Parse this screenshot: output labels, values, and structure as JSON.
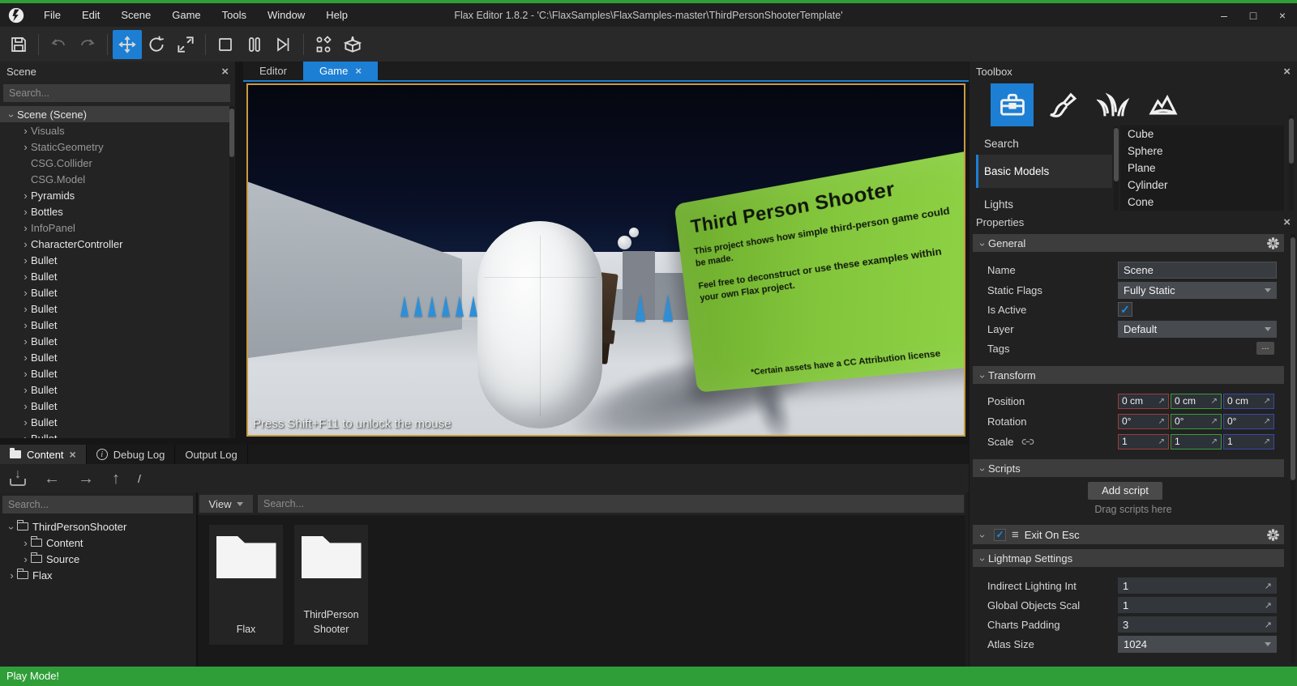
{
  "icons": {
    "close": "×",
    "chevron": "›",
    "minimize": "–",
    "maximize": "□",
    "drag_arrow": "↗",
    "check": "✓",
    "burger": "≡",
    "slash": "/",
    "back": "←",
    "forward": "→",
    "up": "↑",
    "import_arrow": "↓"
  },
  "colors": {
    "accent": "#1d7fd4",
    "play_mode_green": "#2f9e38",
    "viewport_border": "#c89a3f",
    "axis_x": "#9c3c3c",
    "axis_y": "#3c9c3c",
    "axis_z": "#3b49a8",
    "sign_green": "#82c53b"
  },
  "window": {
    "menu_items": [
      "File",
      "Edit",
      "Scene",
      "Game",
      "Tools",
      "Window",
      "Help"
    ],
    "title": "Flax Editor 1.8.2 - 'C:\\FlaxSamples\\FlaxSamples-master\\ThirdPersonShooterTemplate'"
  },
  "scene_panel": {
    "title": "Scene",
    "search_placeholder": "Search...",
    "tree": [
      {
        "label": "Scene (Scene)",
        "chev": "open",
        "depth": 0,
        "selected": true
      },
      {
        "label": "Visuals",
        "chev": "closed",
        "depth": 1,
        "dim": true
      },
      {
        "label": "StaticGeometry",
        "chev": "closed",
        "depth": 1,
        "dim": true
      },
      {
        "label": "CSG.Collider",
        "chev": "none",
        "depth": 1,
        "dim": true
      },
      {
        "label": "CSG.Model",
        "chev": "none",
        "depth": 1,
        "dim": true
      },
      {
        "label": "Pyramids",
        "chev": "closed",
        "depth": 1
      },
      {
        "label": "Bottles",
        "chev": "closed",
        "depth": 1
      },
      {
        "label": "InfoPanel",
        "chev": "closed",
        "depth": 1,
        "dim": true
      },
      {
        "label": "CharacterController",
        "chev": "closed",
        "depth": 1
      },
      {
        "label": "Bullet",
        "chev": "closed",
        "depth": 1
      },
      {
        "label": "Bullet",
        "chev": "closed",
        "depth": 1
      },
      {
        "label": "Bullet",
        "chev": "closed",
        "depth": 1
      },
      {
        "label": "Bullet",
        "chev": "closed",
        "depth": 1
      },
      {
        "label": "Bullet",
        "chev": "closed",
        "depth": 1
      },
      {
        "label": "Bullet",
        "chev": "closed",
        "depth": 1
      },
      {
        "label": "Bullet",
        "chev": "closed",
        "depth": 1
      },
      {
        "label": "Bullet",
        "chev": "closed",
        "depth": 1
      },
      {
        "label": "Bullet",
        "chev": "closed",
        "depth": 1
      },
      {
        "label": "Bullet",
        "chev": "closed",
        "depth": 1
      },
      {
        "label": "Bullet",
        "chev": "closed",
        "depth": 1
      },
      {
        "label": "Bullet",
        "chev": "closed",
        "depth": 1
      }
    ]
  },
  "center": {
    "tabs": [
      {
        "label": "Editor",
        "active": false
      },
      {
        "label": "Game",
        "active": true,
        "closable": true
      }
    ],
    "viewport": {
      "hint": "Press Shift+F11 to unlock the mouse",
      "sign": {
        "title": "Third Person Shooter",
        "paragraphs": [
          "This project shows how simple third-person game could be made.",
          "Feel free to deconstruct or use these examples within your own Flax project."
        ],
        "footnote": "*Certain assets have a CC Attribution license"
      }
    }
  },
  "toolbox": {
    "title": "Toolbox",
    "categories": [
      {
        "label": "Search",
        "tall": false
      },
      {
        "label": "Basic Models",
        "selected": true,
        "tall": true
      },
      {
        "label": "Lights",
        "tall": true
      }
    ],
    "items": [
      "Cube",
      "Sphere",
      "Plane",
      "Cylinder",
      "Cone"
    ]
  },
  "properties": {
    "title": "Properties",
    "general": {
      "header": "General",
      "name_label": "Name",
      "name_value": "Scene",
      "static_flags_label": "Static Flags",
      "static_flags_value": "Fully Static",
      "is_active_label": "Is Active",
      "is_active_checked": true,
      "layer_label": "Layer",
      "layer_value": "Default",
      "tags_label": "Tags",
      "tags_button": "..."
    },
    "transform": {
      "header": "Transform",
      "position_label": "Position",
      "rotation_label": "Rotation",
      "scale_label": "Scale",
      "position": [
        "0 cm",
        "0 cm",
        "0 cm"
      ],
      "rotation": [
        "0°",
        "0°",
        "0°"
      ],
      "scale": [
        "1",
        "1",
        "1"
      ]
    },
    "scripts": {
      "header": "Scripts",
      "add_button": "Add script",
      "drop_hint": "Drag scripts here",
      "script_name": "Exit On Esc",
      "script_enabled": true
    },
    "lightmap": {
      "header": "Lightmap Settings",
      "rows": [
        {
          "label": "Indirect Lighting Int",
          "value": "1"
        },
        {
          "label": "Global Objects Scal",
          "value": "1"
        },
        {
          "label": "Charts Padding",
          "value": "3"
        },
        {
          "label": "Atlas Size",
          "value": "1024"
        }
      ]
    }
  },
  "content_panel": {
    "tabs": [
      {
        "label": "Content",
        "active": true,
        "folder": true,
        "closable": true
      },
      {
        "label": "Debug Log",
        "info": true
      },
      {
        "label": "Output Log"
      }
    ],
    "breadcrumb": "/",
    "tree_search_placeholder": "Search...",
    "view_button": "View",
    "search_placeholder": "Search...",
    "tree": [
      {
        "label": "ThirdPersonShooter",
        "chev": "open",
        "depth": 0
      },
      {
        "label": "Content",
        "chev": "closed",
        "depth": 1
      },
      {
        "label": "Source",
        "chev": "closed",
        "depth": 1
      },
      {
        "label": "Flax",
        "chev": "closed",
        "depth": 0
      }
    ],
    "tiles": [
      {
        "label": "Flax"
      },
      {
        "label": "ThirdPerson Shooter"
      }
    ]
  },
  "status_bar": {
    "text": "Play Mode!"
  }
}
